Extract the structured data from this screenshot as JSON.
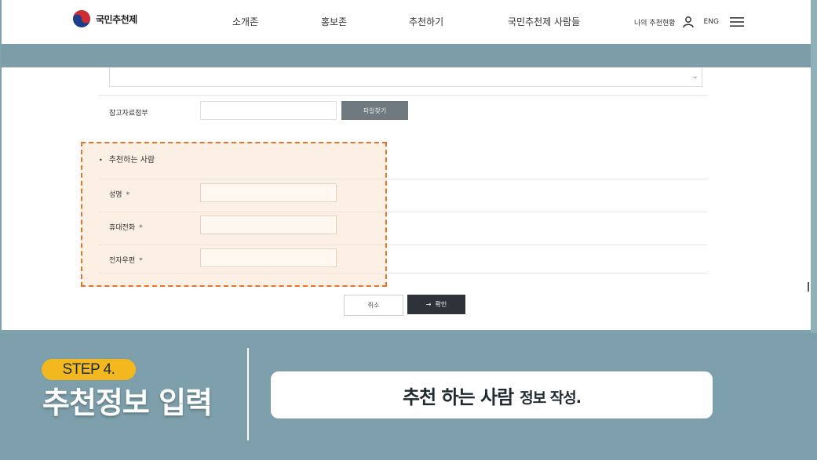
{
  "header": {
    "logo_text": "국민추천제",
    "nav": [
      "소개존",
      "홍보존",
      "추천하기",
      "국민추천제 사람들"
    ],
    "my_status": "나의 추천현황",
    "lang": "ENG"
  },
  "form": {
    "attachment_label": "참고자료첨부",
    "file_button": "파일찾기",
    "section_title": "추천하는 사람",
    "fields": [
      {
        "label": "성명",
        "required": "*"
      },
      {
        "label": "휴대전화",
        "required": "*"
      },
      {
        "label": "전자우편",
        "required": "*"
      }
    ],
    "cancel": "취소",
    "confirm": "확인",
    "confirm_arrow": "→"
  },
  "caption": {
    "step": "STEP 4.",
    "title": "추천정보 입력",
    "text_main": "추천 하는 사람",
    "text_sub": "정보 작성."
  },
  "colors": {
    "accent_band": "#7d9ea9",
    "highlight_border": "#e8742c",
    "step_badge": "#f4b81f",
    "confirm_button": "#2d3338"
  }
}
